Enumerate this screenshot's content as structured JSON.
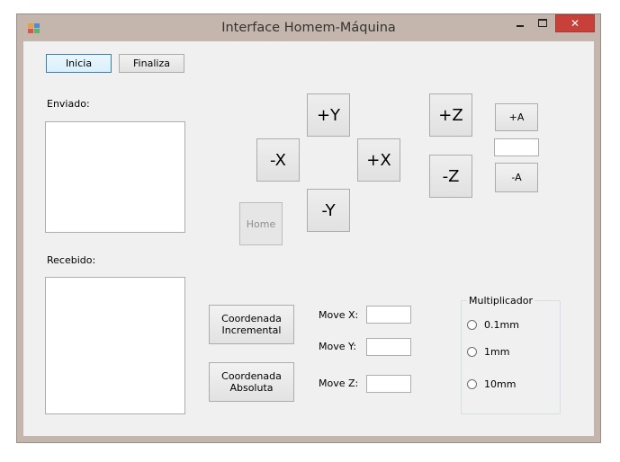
{
  "window": {
    "title": "Interface Homem-Máquina",
    "close_glyph": "✕"
  },
  "buttons": {
    "inicia": "Inicia",
    "finaliza": "Finaliza",
    "plus_y": "+Y",
    "minus_x": "-X",
    "plus_x": "+X",
    "minus_y": "-Y",
    "home": "Home",
    "plus_z": "+Z",
    "minus_z": "-Z",
    "plus_a": "+A",
    "minus_a": "-A",
    "coord_incremental": "Coordenada\nIncremental",
    "coord_absoluta": "Coordenada\nAbsoluta"
  },
  "labels": {
    "enviado": "Enviado:",
    "recebido": "Recebido:",
    "move_x": "Move  X:",
    "move_y": "Move Y:",
    "move_z": "Move Z:"
  },
  "inputs": {
    "a_value": "",
    "move_x": "",
    "move_y": "",
    "move_z": ""
  },
  "multiplicador": {
    "title": "Multiplicador",
    "options": [
      "0.1mm",
      "1mm",
      "10mm"
    ]
  }
}
